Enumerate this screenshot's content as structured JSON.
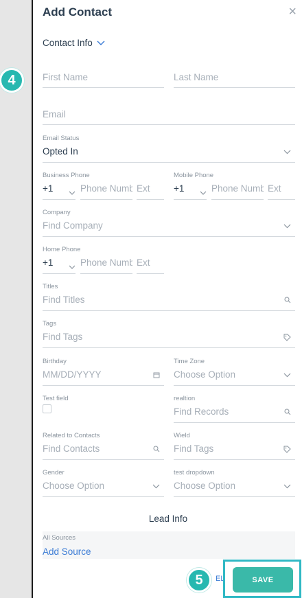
{
  "modal": {
    "title": "Add Contact",
    "close_icon": "×",
    "section_contact": "Contact Info",
    "section_lead": "Lead Info"
  },
  "fields": {
    "first_name": {
      "placeholder": "First Name"
    },
    "last_name": {
      "placeholder": "Last Name"
    },
    "email": {
      "placeholder": "Email"
    },
    "email_status": {
      "label": "Email Status",
      "value": "Opted In"
    },
    "business_phone": {
      "label": "Business Phone",
      "code": "+1",
      "placeholder": "Phone Numb",
      "ext": "Ext"
    },
    "mobile_phone": {
      "label": "Mobile Phone",
      "code": "+1",
      "placeholder": "Phone Numb",
      "ext": "Ext"
    },
    "company": {
      "label": "Company",
      "placeholder": "Find Company"
    },
    "home_phone": {
      "label": "Home Phone",
      "code": "+1",
      "placeholder": "Phone Numb",
      "ext": "Ext"
    },
    "titles": {
      "label": "Titles",
      "placeholder": "Find Titles"
    },
    "tags": {
      "label": "Tags",
      "placeholder": "Find Tags"
    },
    "birthday": {
      "label": "Birthday",
      "placeholder": "MM/DD/YYYY"
    },
    "time_zone": {
      "label": "Time Zone",
      "placeholder": "Choose Option"
    },
    "test_field": {
      "label": "Test field"
    },
    "realtion": {
      "label": "realtion",
      "placeholder": "Find Records"
    },
    "related_contacts": {
      "label": "Related to Contacts",
      "placeholder": "Find Contacts"
    },
    "wield": {
      "label": "Wield",
      "placeholder": "Find Tags"
    },
    "gender": {
      "label": "Gender",
      "placeholder": "Choose Option"
    },
    "test_dropdown": {
      "label": "test dropdown",
      "placeholder": "Choose Option"
    },
    "all_sources": {
      "label": "All Sources",
      "link": "Add Source"
    }
  },
  "footer": {
    "save_label": "SAVE",
    "partial_text": "EL"
  },
  "badges": {
    "step4": "4",
    "step5": "5"
  },
  "colors": {
    "accent": "#3ab9a9",
    "badge": "#27b8b0",
    "highlight": "#2fb8c4",
    "link": "#3a7bd5"
  }
}
